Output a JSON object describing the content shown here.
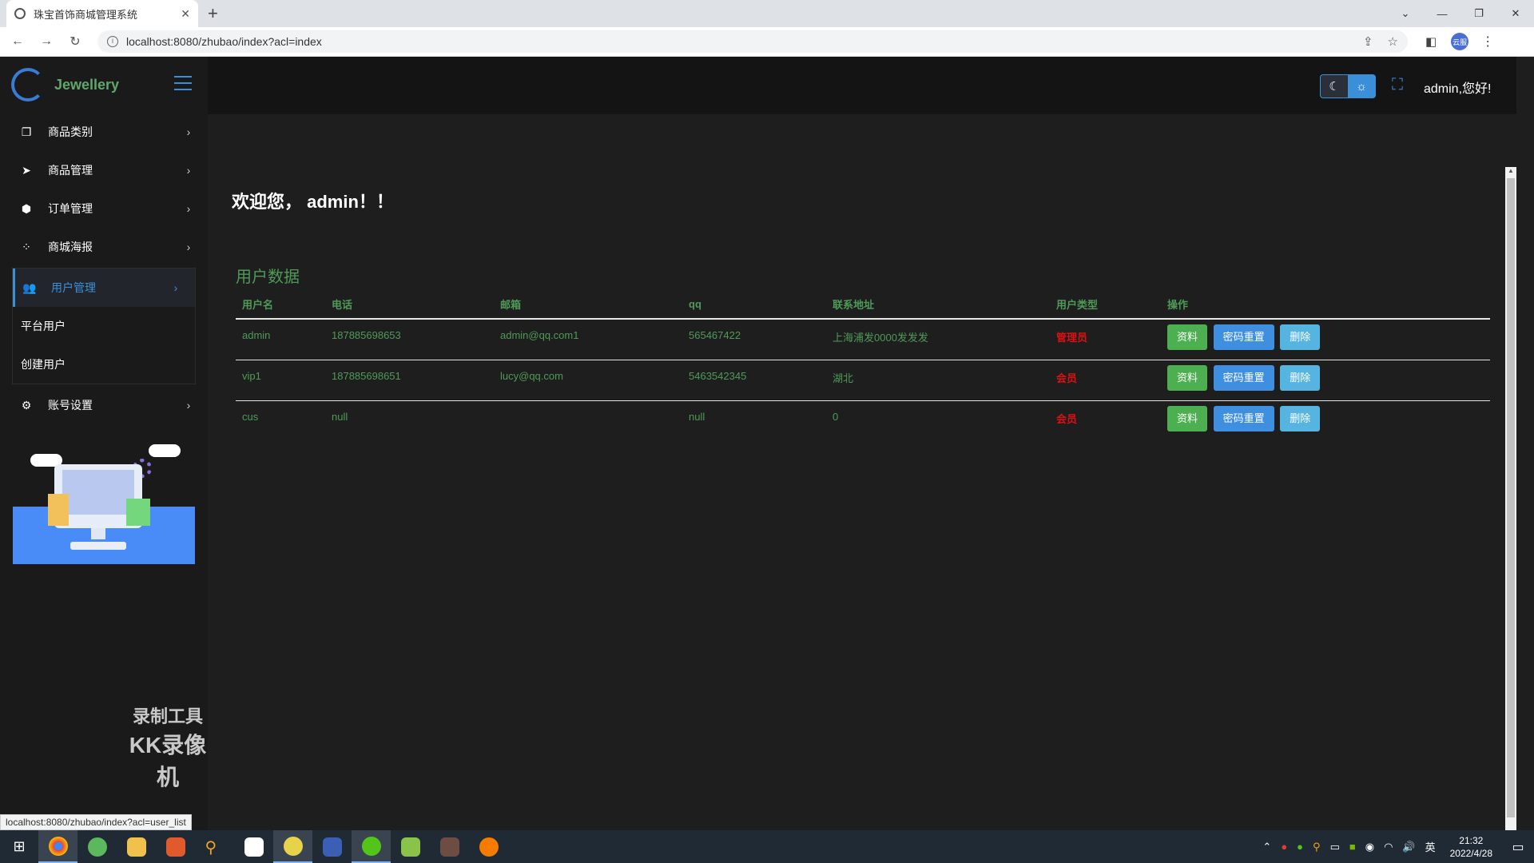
{
  "browser": {
    "tab_title": "珠宝首饰商城管理系统",
    "url": "localhost:8080/zhubao/index?acl=index",
    "profile_label": "云服",
    "status_url": "localhost:8080/zhubao/index?acl=user_list"
  },
  "brand": {
    "name": "Jewellery"
  },
  "sidebar": {
    "items": [
      {
        "label": "商品类别",
        "icon": "copy-icon"
      },
      {
        "label": "商品管理",
        "icon": "paper-plane-icon"
      },
      {
        "label": "订单管理",
        "icon": "box-icon"
      },
      {
        "label": "商城海报",
        "icon": "spinner-icon"
      }
    ],
    "active_group": {
      "label": "用户管理",
      "icon": "users-icon",
      "subitems": [
        "平台用户",
        "创建用户"
      ]
    },
    "settings": {
      "label": "账号设置",
      "icon": "gear-icon"
    }
  },
  "header": {
    "greeting": "admin,您好!"
  },
  "main": {
    "welcome": "欢迎您， admin！！",
    "section_title": "用户数据",
    "table": {
      "columns": [
        "用户名",
        "电话",
        "邮箱",
        "qq",
        "联系地址",
        "用户类型",
        "操作"
      ],
      "rows": [
        {
          "username": "admin",
          "phone": "187885698653",
          "email": "admin@qq.com1",
          "qq": "565467422",
          "address": "上海浦发0000发发发",
          "role": "管理员"
        },
        {
          "username": "vip1",
          "phone": "187885698651",
          "email": "lucy@qq.com",
          "qq": "5463542345",
          "address": "湖北",
          "role": "会员"
        },
        {
          "username": "cus",
          "phone": "null",
          "email": "",
          "qq": "null",
          "address": "0",
          "role": "会员"
        }
      ],
      "actions": {
        "profile": "资料",
        "reset": "密码重置",
        "delete": "删除"
      }
    }
  },
  "watermark": {
    "line1": "录制工具",
    "line2": "KK录像机"
  },
  "taskbar": {
    "time": "21:32",
    "date": "2022/4/28",
    "ime": "英"
  },
  "colors": {
    "accent": "#3a8fd8",
    "green_text": "#4f9a58",
    "role_red": "#dd1111"
  }
}
